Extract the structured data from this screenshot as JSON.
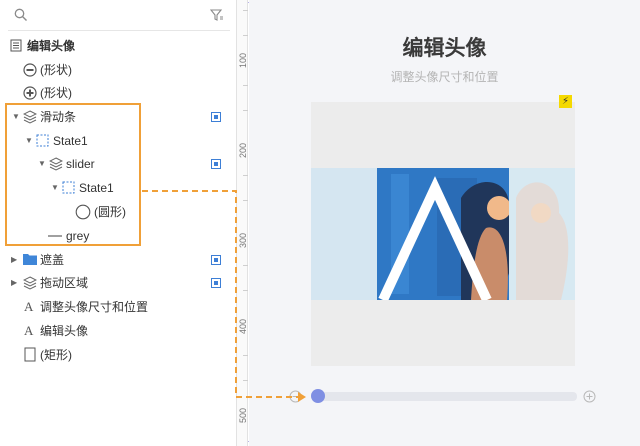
{
  "search": {
    "icon": "search-icon",
    "filter_icon": "filter-icon"
  },
  "layers": [
    {
      "label": "编辑头像",
      "icon": "page-icon",
      "bold": true
    },
    {
      "label": "(形状)",
      "icon": "minus-circle-icon"
    },
    {
      "label": "(形状)",
      "icon": "plus-circle-icon"
    },
    {
      "label": "滑动条",
      "icon": "layers-icon",
      "expanded": true
    },
    {
      "label": "State1",
      "icon": "state-icon",
      "expanded": true
    },
    {
      "label": "slider",
      "icon": "layers-icon",
      "expanded": true
    },
    {
      "label": "State1",
      "icon": "state-icon",
      "expanded": true
    },
    {
      "label": "(圆形)",
      "icon": "circle-icon"
    },
    {
      "label": "grey",
      "icon": "line-icon"
    },
    {
      "label": "遮盖",
      "icon": "folder-icon",
      "expanded": false
    },
    {
      "label": "拖动区域",
      "icon": "layers-icon",
      "expanded": false
    },
    {
      "label": "调整头像尺寸和位置",
      "icon": "text-icon"
    },
    {
      "label": "编辑头像",
      "icon": "text-icon"
    },
    {
      "label": "(矩形)",
      "icon": "rectangle-icon"
    }
  ],
  "ruler": {
    "ticks": [
      "100",
      "200",
      "300",
      "400",
      "500"
    ]
  },
  "canvas": {
    "title": "编辑头像",
    "subtitle": "调整头像尺寸和位置",
    "slider_value": 0
  },
  "colors": {
    "highlight": "#f0a038",
    "accent": "#7f8fe3",
    "selection_blue": "#3d7fd6",
    "frame_dash": "#b9b2e8"
  }
}
